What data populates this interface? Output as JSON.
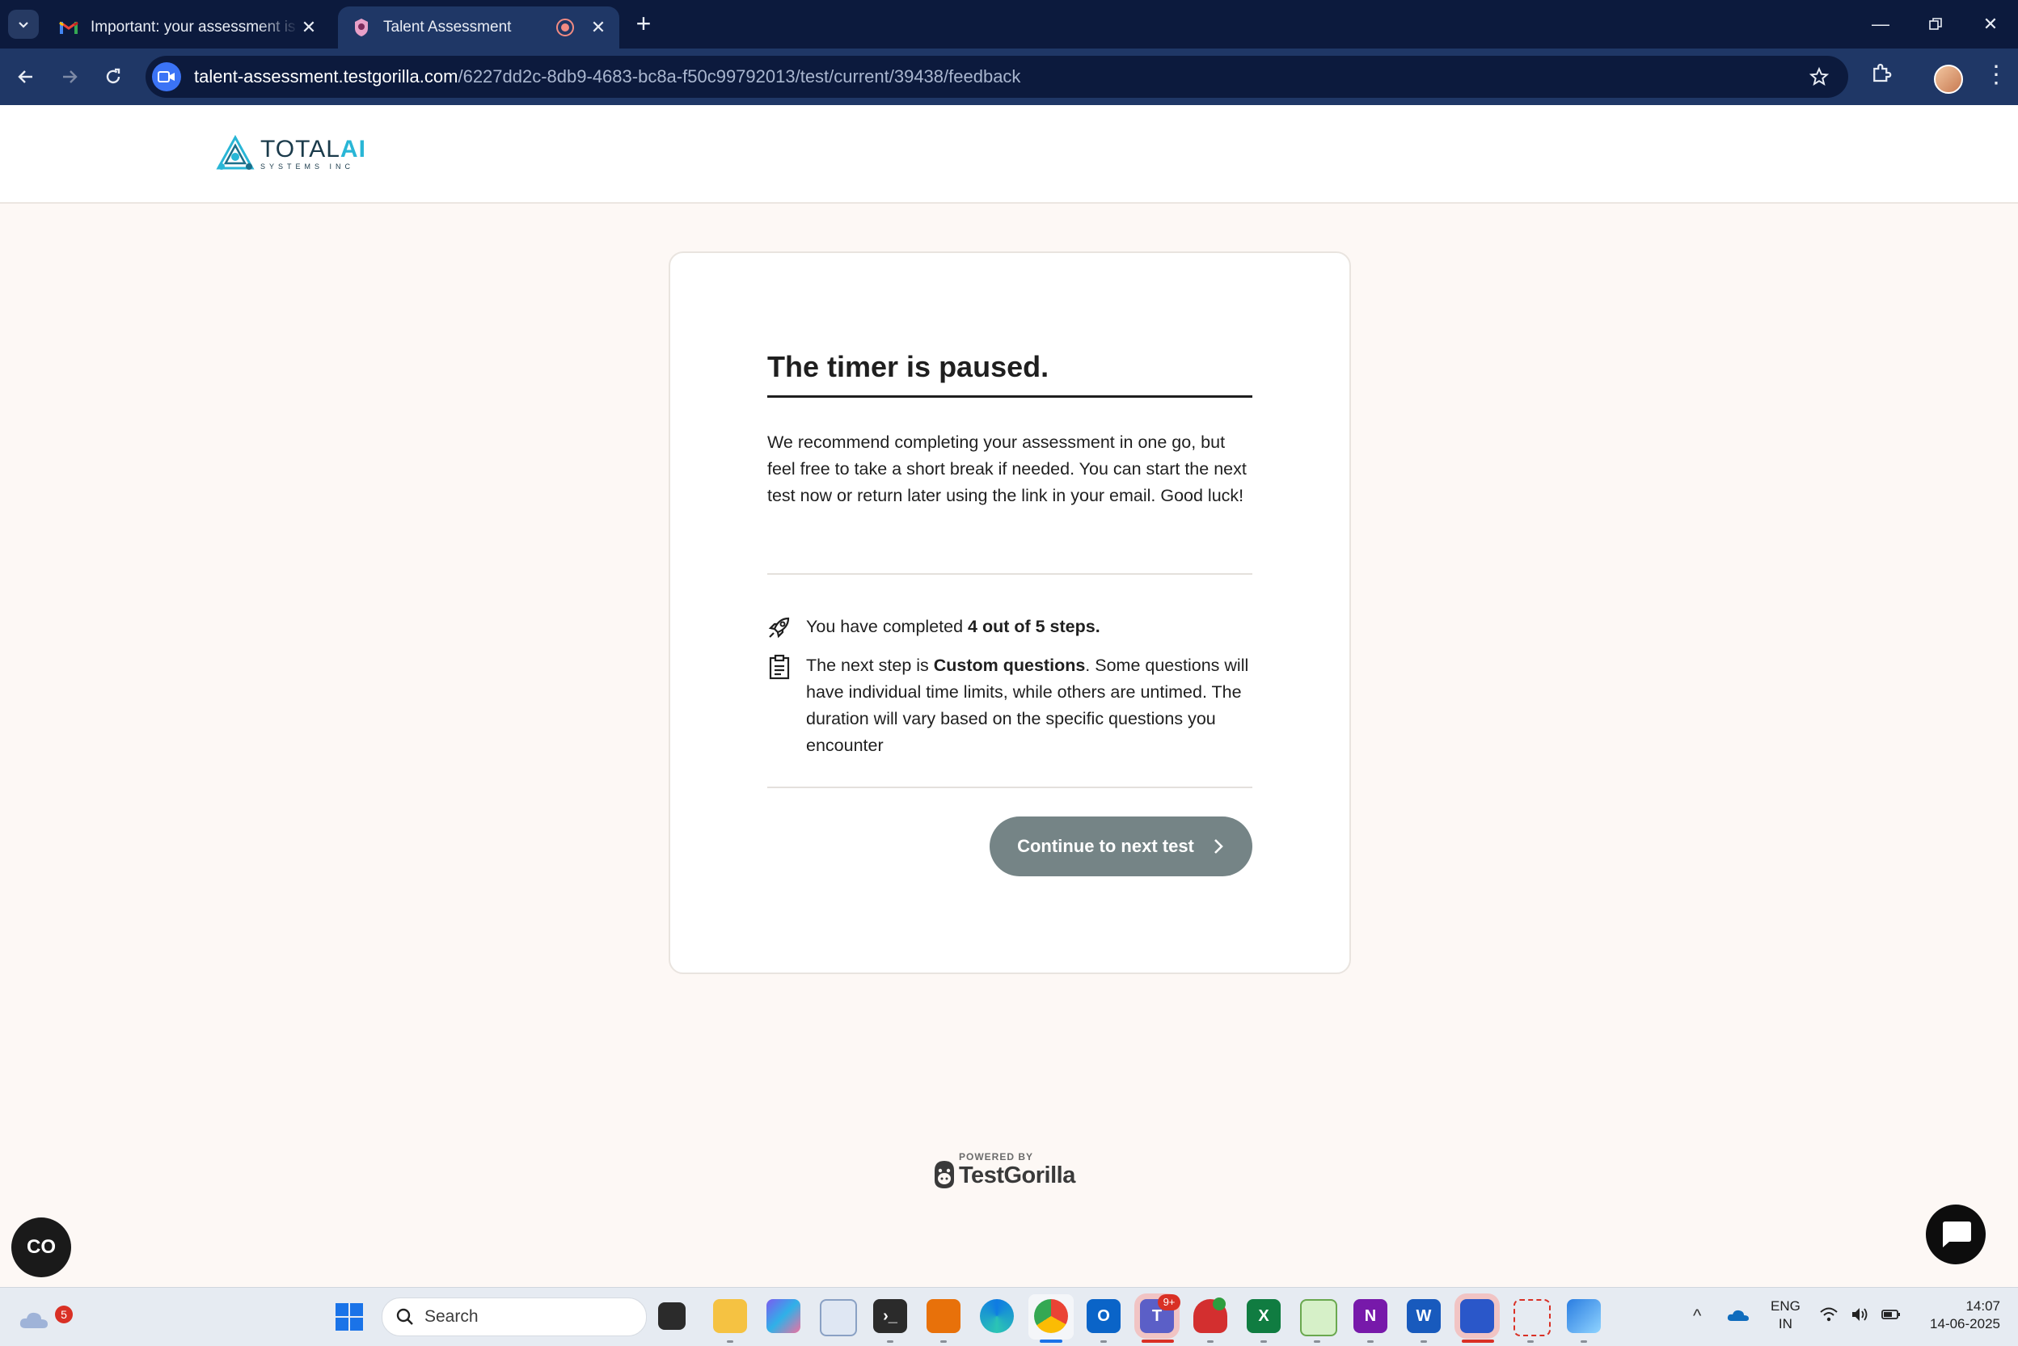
{
  "browser": {
    "tabs": [
      {
        "title": "Important: your assessment is w",
        "active": false
      },
      {
        "title": "Talent Assessment",
        "active": true
      }
    ],
    "url_host": "talent-assessment.testgorilla.com",
    "url_path": "/6227dd2c-8db9-4683-bc8a-f50c99792013/test/current/39438/feedback"
  },
  "header": {
    "logo_word": "TOTAL",
    "logo_word_accent": "AI",
    "logo_sub": "SYSTEMS INC"
  },
  "card": {
    "title": "The timer is paused.",
    "intro": "We recommend completing your assessment in one go, but feel free to take a short break if needed. You can start the next test now or return later using the link in your email. Good luck!",
    "progress_prefix": "You have completed ",
    "progress_bold": "4 out of 5 steps.",
    "next_prefix": "The next step is ",
    "next_bold": "Custom questions",
    "next_suffix": ". Some questions will have individual time limits, while others are untimed. The duration will vary based on the specific questions you encounter",
    "continue_label": "Continue to next test"
  },
  "footer": {
    "powered_by": "POWERED BY",
    "brand": "TestGorilla"
  },
  "widgets": {
    "a11y_label": "CO"
  },
  "taskbar": {
    "weather_badge": "5",
    "search_placeholder": "Search",
    "teams_badge": "9+",
    "lang_top": "ENG",
    "lang_bottom": "IN",
    "time": "14:07",
    "date": "14-06-2025"
  },
  "colors": {
    "page_bg": "#fdf8f5",
    "chrome_dark": "#0c1a3d",
    "chrome_toolbar": "#1f3766",
    "button_bg": "#758486",
    "logo_accent": "#29b6d6"
  }
}
